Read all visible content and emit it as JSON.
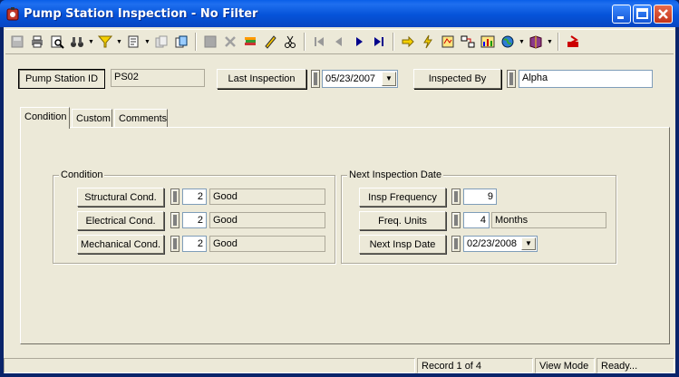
{
  "window": {
    "title": "Pump Station Inspection - No Filter"
  },
  "toolbar": {
    "icons": [
      "save-icon",
      "print-icon",
      "print-preview-icon",
      "binoculars-icon",
      "filter-icon",
      "records-icon",
      "copy-icon",
      "duplicate-icon",
      "save-record-icon",
      "delete-icon",
      "edit-books-icon",
      "pencil-icon",
      "scissors-icon",
      "first-record-icon",
      "previous-record-icon",
      "next-record-icon",
      "last-record-icon",
      "go-to-icon",
      "lightning-icon",
      "map-icon",
      "link-icon",
      "chart-icon",
      "globe-icon",
      "book-icon",
      "exit-icon"
    ]
  },
  "header": {
    "station_id_label": "Pump Station ID",
    "station_id_value": "PS02",
    "last_inspection_label": "Last Inspection",
    "last_inspection_value": "05/23/2007",
    "inspected_by_label": "Inspected By",
    "inspected_by_value": "Alpha"
  },
  "tabs": [
    {
      "label": "Condition",
      "active": true
    },
    {
      "label": "Custom"
    },
    {
      "label": "Comments"
    }
  ],
  "condition": {
    "title": "Condition",
    "rows": [
      {
        "label": "Structural Cond.",
        "code": "2",
        "desc": "Good"
      },
      {
        "label": "Electrical Cond.",
        "code": "2",
        "desc": "Good"
      },
      {
        "label": "Mechanical Cond.",
        "code": "2",
        "desc": "Good"
      }
    ]
  },
  "next_inspection": {
    "title": "Next Inspection Date",
    "freq_label": "Insp Frequency",
    "freq_value": "9",
    "units_label": "Freq. Units",
    "units_code": "4",
    "units_desc": "Months",
    "next_date_label": "Next Insp Date",
    "next_date_value": "02/23/2008"
  },
  "status": {
    "record": "Record 1 of 4",
    "mode": "View Mode",
    "state": "Ready..."
  }
}
